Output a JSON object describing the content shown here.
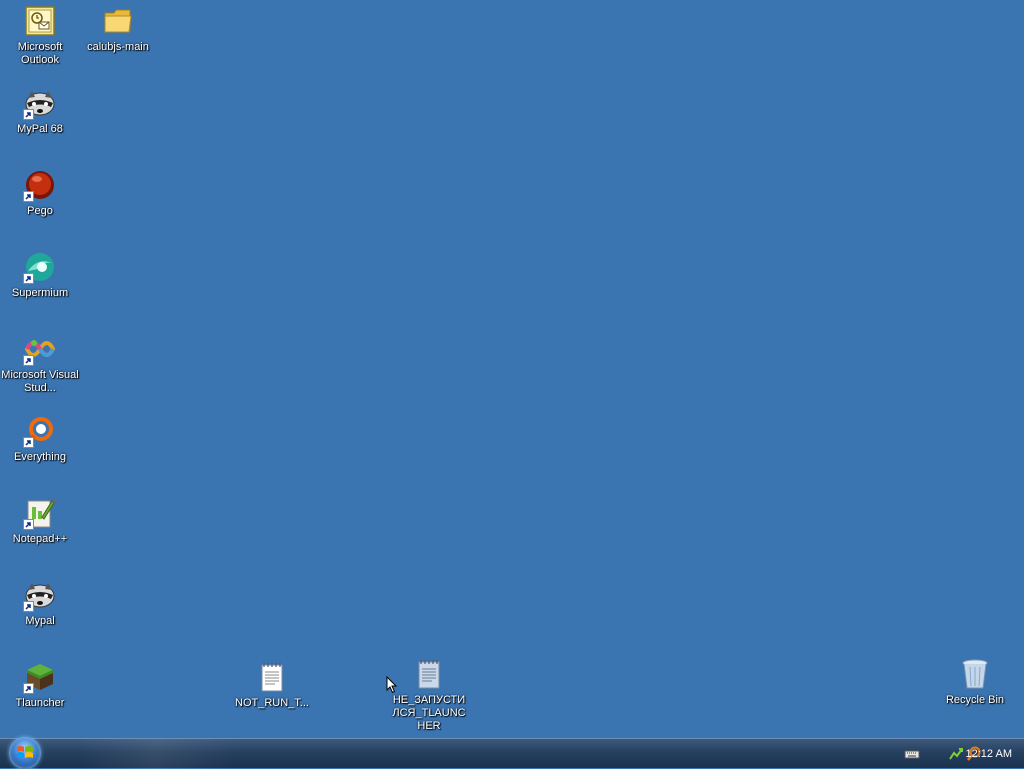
{
  "desktop": {
    "icons": [
      {
        "name": "microsoft-outlook",
        "label": "Microsoft Outlook"
      },
      {
        "name": "calubjs-main",
        "label": "calubjs-main"
      },
      {
        "name": "mypal-68",
        "label": "MyPal 68"
      },
      {
        "name": "pego",
        "label": "Pego"
      },
      {
        "name": "supermium",
        "label": "Supermium"
      },
      {
        "name": "microsoft-visual-studio",
        "label": "Microsoft Visual Stud..."
      },
      {
        "name": "everything",
        "label": "Everything"
      },
      {
        "name": "notepad-plus-plus",
        "label": "Notepad++"
      },
      {
        "name": "mypal",
        "label": "Mypal"
      },
      {
        "name": "tlauncher",
        "label": "Tlauncher"
      },
      {
        "name": "not-run-file",
        "label": "NOT_RUN_T..."
      },
      {
        "name": "ne-zapustilsya-file",
        "label": "НЕ_ЗАПУСТИЛСЯ_TLAUNCHER"
      },
      {
        "name": "recycle-bin",
        "label": "Recycle Bin"
      }
    ]
  },
  "taskbar": {
    "clock": "12:12 AM",
    "tray_icons": [
      "keyboard-icon",
      "network-icon",
      "search-icon"
    ]
  },
  "colors": {
    "desktop": "#3a74b1",
    "taskbar": "#1f3858"
  }
}
